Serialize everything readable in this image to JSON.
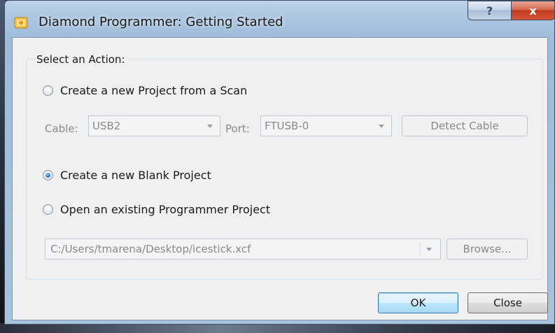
{
  "window": {
    "title": "Diamond Programmer: Getting Started",
    "help_label": "?",
    "close_label": "x"
  },
  "group": {
    "label": "Select an Action:"
  },
  "options": {
    "scan_label": "Create a new Project from a Scan",
    "blank_label": "Create a new Blank Project",
    "open_label": "Open an existing Programmer Project",
    "selected": "blank"
  },
  "scan": {
    "cable_label": "Cable:",
    "cable_value": "USB2",
    "port_label": "Port:",
    "port_value": "FTUSB-0",
    "detect_label": "Detect Cable"
  },
  "open": {
    "path_value": "C:/Users/tmarena/Desktop/icestick.xcf",
    "browse_label": "Browse..."
  },
  "footer": {
    "ok_label": "OK",
    "close_label": "Close"
  }
}
